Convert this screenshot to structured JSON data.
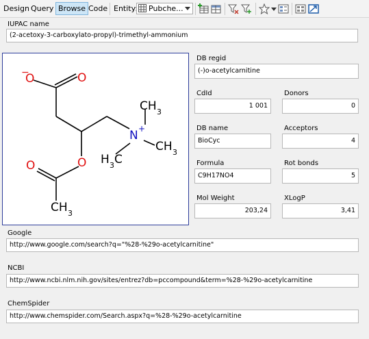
{
  "toolbar": {
    "tabs": [
      "Design",
      "Query",
      "Browse",
      "Code"
    ],
    "active_tab": "Browse",
    "entity_label": "Entity:",
    "entity_value": "Pubche..."
  },
  "record": {
    "iupac_label": "IUPAC name",
    "iupac_value": "(2-acetoxy-3-carboxylato-propyl)-trimethyl-ammonium",
    "db_regid_label": "DB regid",
    "db_regid_value": "(-)o-acetylcarnitine",
    "cdid_label": "CdId",
    "cdid_value": "1 001",
    "donors_label": "Donors",
    "donors_value": "0",
    "db_name_label": "DB name",
    "db_name_value": "BioCyc",
    "acceptors_label": "Acceptors",
    "acceptors_value": "4",
    "formula_label": "Formula",
    "formula_value": "C9H17NO4",
    "rot_bonds_label": "Rot bonds",
    "rot_bonds_value": "5",
    "mol_weight_label": "Mol Weight",
    "mol_weight_value": "203,24",
    "xlogp_label": "XLogP",
    "xlogp_value": "3,41",
    "google_label": "Google",
    "google_value": "http://www.google.com/search?q=\"%28-%29o-acetylcarnitine\"",
    "ncbi_label": "NCBI",
    "ncbi_value": "http://www.ncbi.nlm.nih.gov/sites/entrez?db=pccompound&term=%28-%29o-acetylcarnitine",
    "chemspider_label": "ChemSpider",
    "chemspider_value": "http://www.chemspider.com/Search.aspx?q=%28-%29o-acetylcarnitine"
  },
  "structure": {
    "atoms": {
      "o_carboxylate_minus": "O",
      "o_carboxylate_double": "O",
      "nitrogen": "N",
      "o_ester": "O",
      "o_carbonyl": "O",
      "ch3_top": "CH",
      "ch3_top_sub": "3",
      "ch3_right": "CH",
      "ch3_right_sub": "3",
      "h3c_left": "H",
      "h3c_left_sub": "3",
      "h3c_left_c": "C",
      "ch3_bottom": "CH",
      "ch3_bottom_sub": "3"
    },
    "charges": {
      "minus": "−",
      "plus": "+"
    },
    "colors": {
      "oxygen": "#e01010",
      "nitrogen": "#1010c0",
      "carbon": "#000000"
    }
  }
}
